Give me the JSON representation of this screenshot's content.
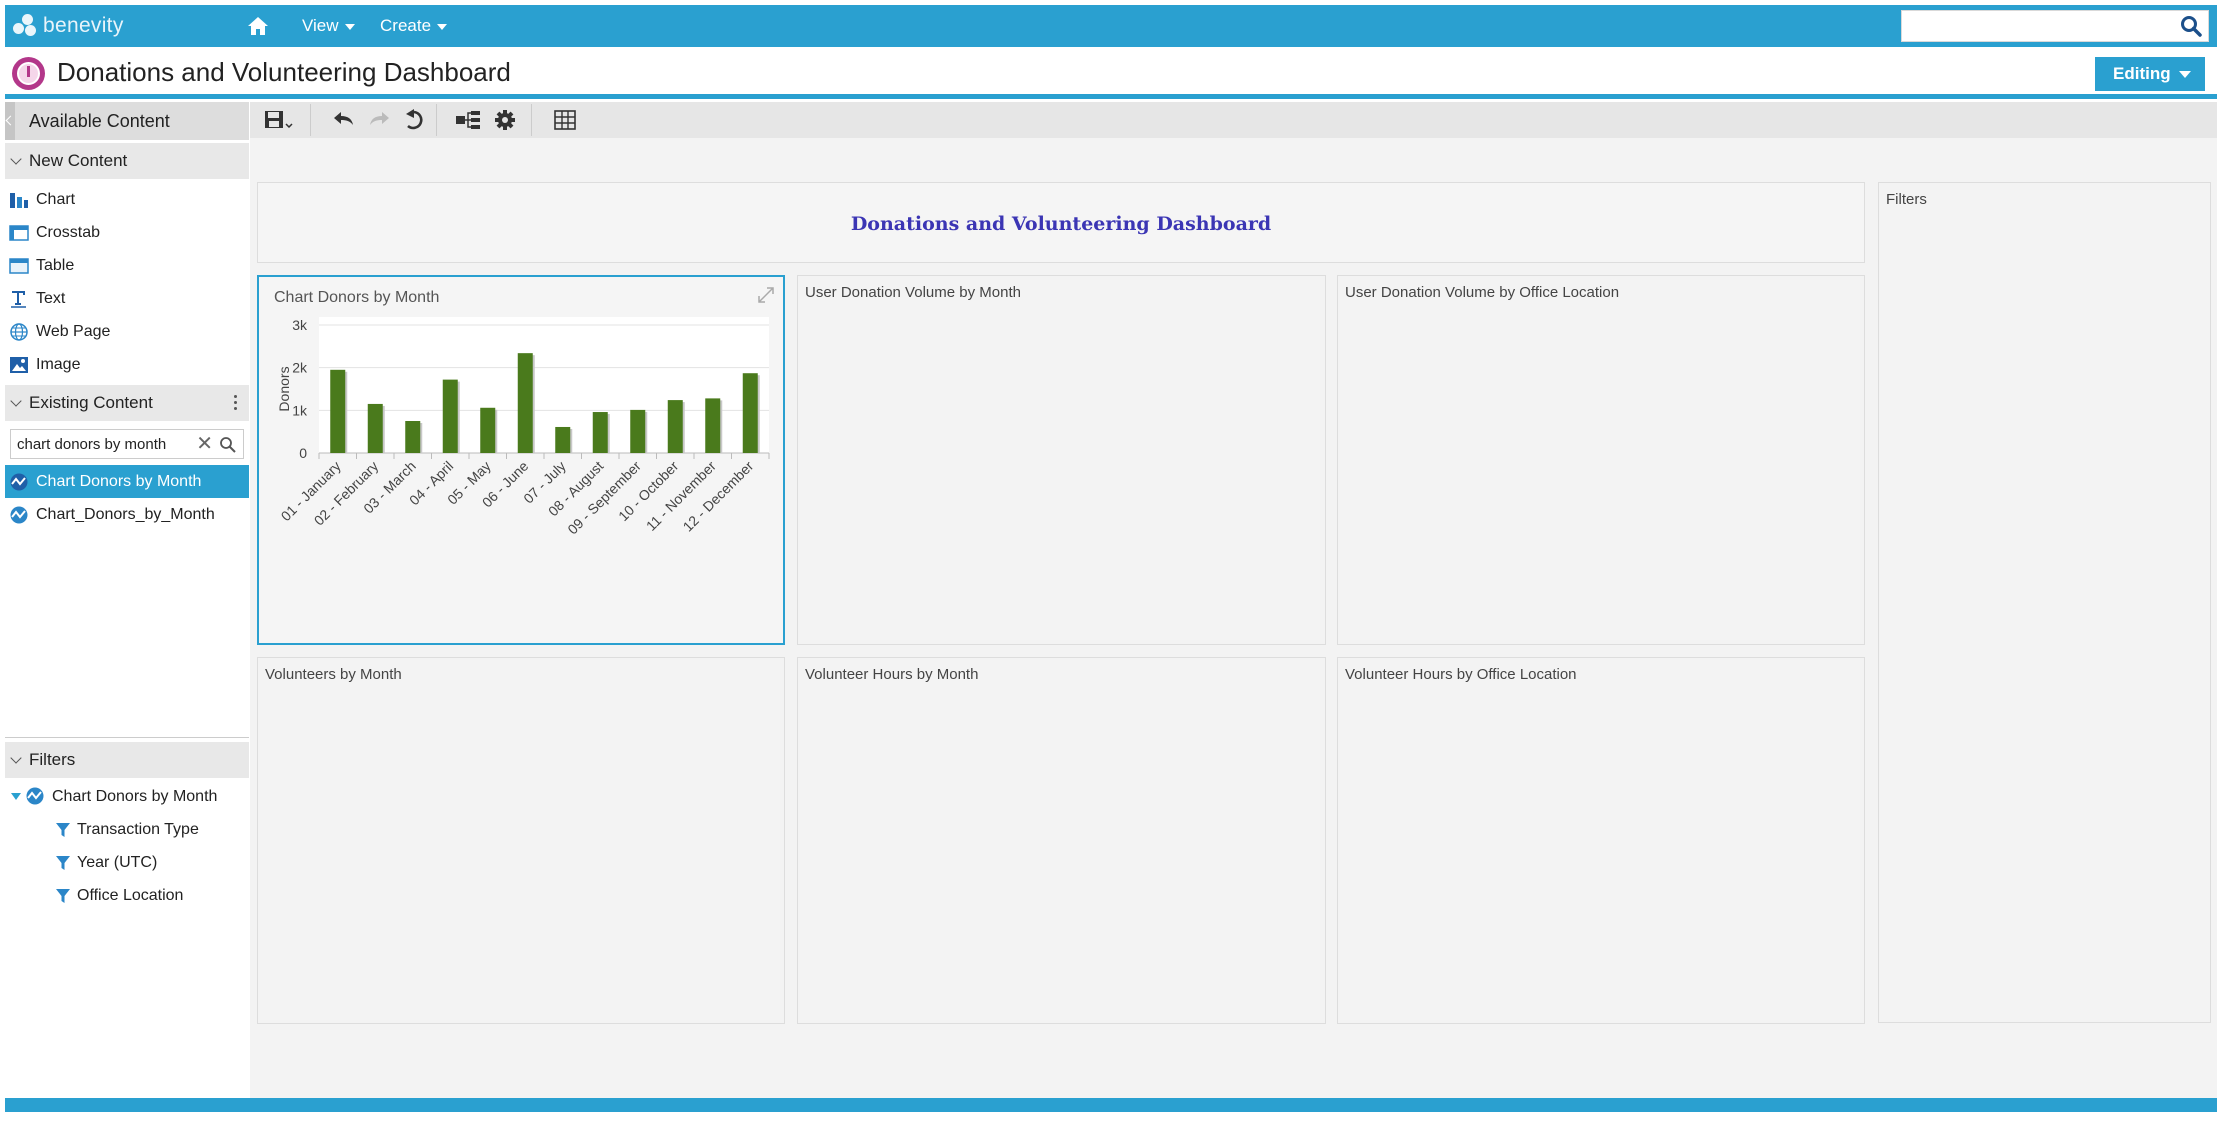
{
  "topbar": {
    "brand": "benevity",
    "nav": [
      {
        "label": "View"
      },
      {
        "label": "Create"
      }
    ],
    "search_placeholder": ""
  },
  "titlebar": {
    "title": "Donations and Volunteering Dashboard",
    "mode_label": "Editing"
  },
  "sidebar": {
    "available_label": "Available Content",
    "new_content_label": "New Content",
    "new_items": [
      {
        "label": "Chart",
        "icon": "bar-chart-icon"
      },
      {
        "label": "Crosstab",
        "icon": "crosstab-icon"
      },
      {
        "label": "Table",
        "icon": "table-icon"
      },
      {
        "label": "Text",
        "icon": "text-icon"
      },
      {
        "label": "Web Page",
        "icon": "globe-icon"
      },
      {
        "label": "Image",
        "icon": "image-icon"
      }
    ],
    "existing_label": "Existing Content",
    "search_value": "chart donors by month",
    "existing_items": [
      {
        "label": "Chart Donors by Month",
        "selected": true
      },
      {
        "label": "Chart_Donors_by_Month",
        "selected": false
      }
    ],
    "filters_label": "Filters",
    "filter_chart": "Chart Donors by Month",
    "filter_fields": [
      "Transaction Type",
      "Year (UTC)",
      "Office Location"
    ]
  },
  "canvas": {
    "dashboard_title": "Donations and Volunteering Dashboard",
    "filters_panel_title": "Filters",
    "chart_panel_title": "Chart Donors by Month",
    "panels": [
      "User Donation Volume by Month",
      "User Donation Volume by Office Location",
      "Volunteers by Month",
      "Volunteer Hours by Month",
      "Volunteer Hours by Office Location"
    ]
  },
  "chart_data": {
    "type": "bar",
    "title": "Chart Donors by Month",
    "ylabel": "Donors",
    "xlabel": "",
    "categories": [
      "01 - January",
      "02 - February",
      "03 - March",
      "04 - April",
      "05 - May",
      "06 - June",
      "07 - July",
      "08 - August",
      "09 - September",
      "10 - October",
      "11 - November",
      "12 - December"
    ],
    "values": [
      1950,
      1150,
      750,
      1720,
      1060,
      2340,
      610,
      960,
      1010,
      1240,
      1280,
      1870
    ],
    "ylim": [
      0,
      3000
    ],
    "yticks": [
      "0",
      "1k",
      "2k",
      "3k"
    ],
    "bar_color": "#4a7a1c",
    "grid": true
  }
}
